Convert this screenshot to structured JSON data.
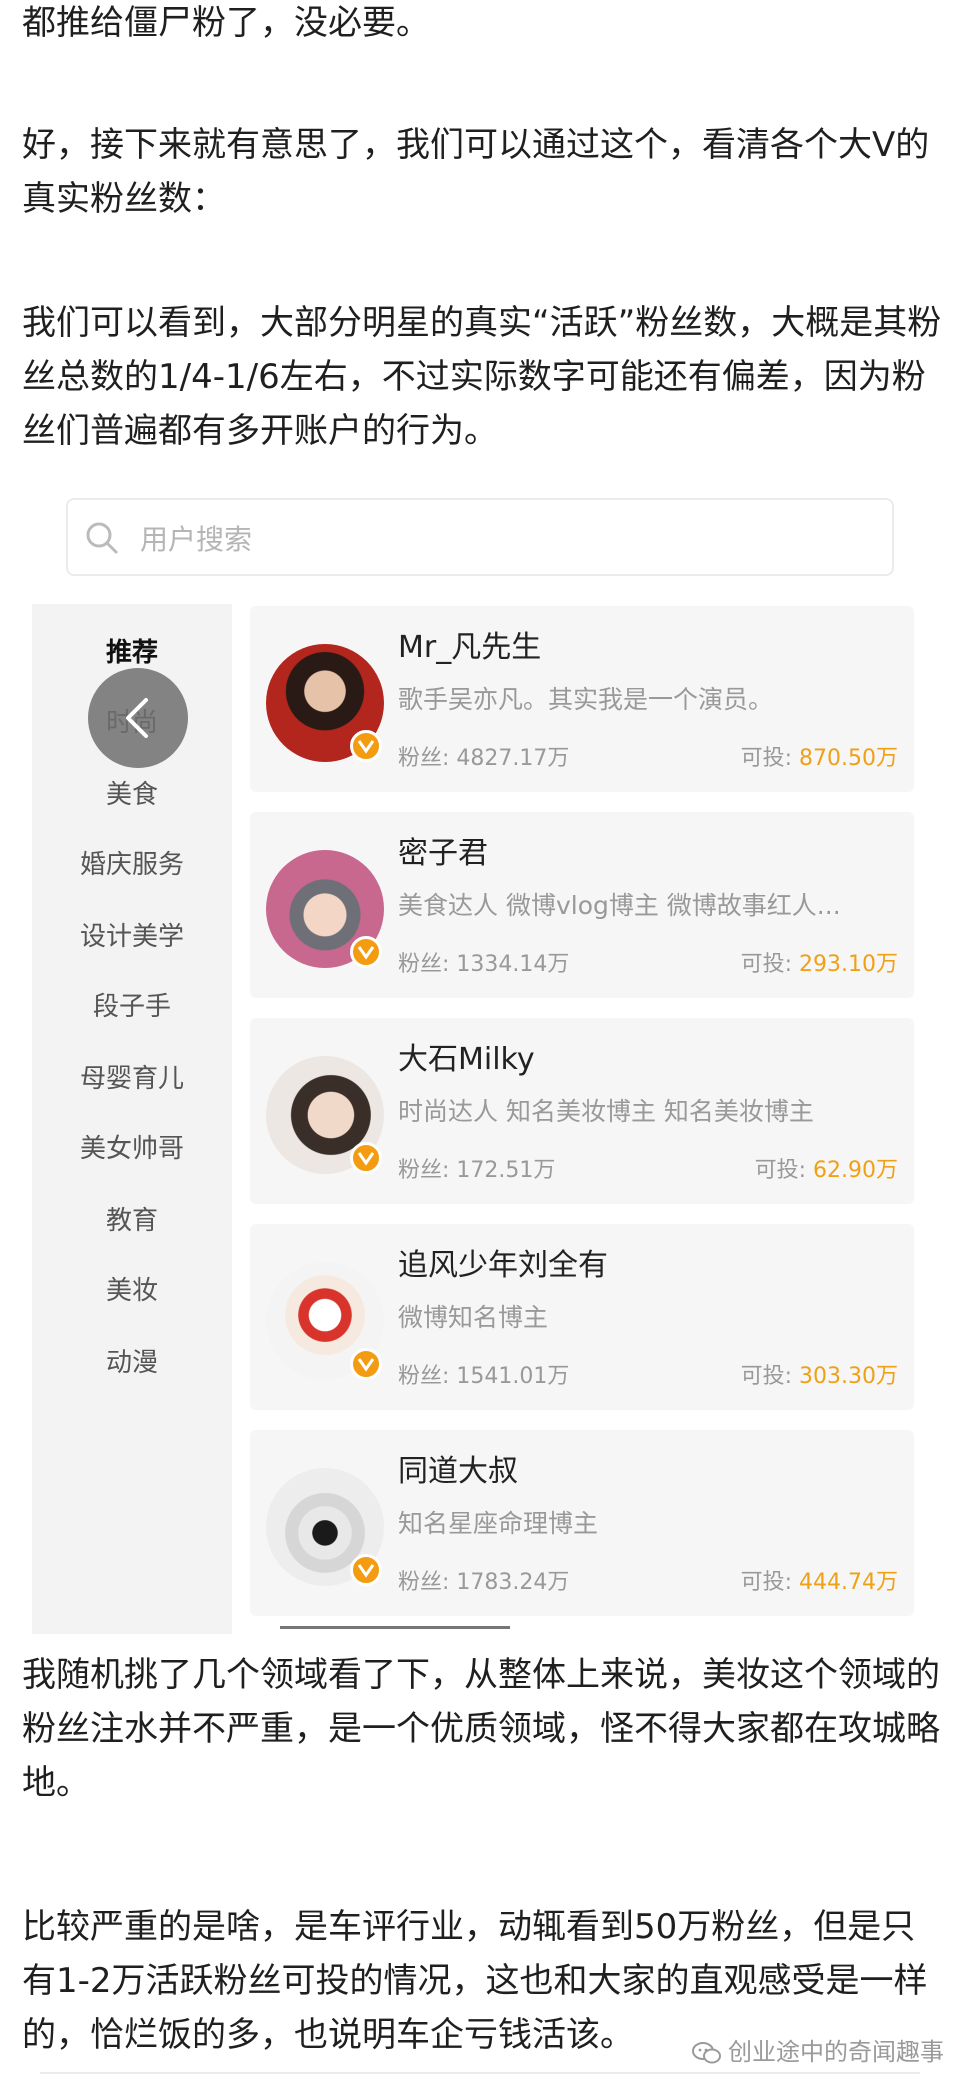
{
  "article": {
    "p0": "都推给僵尸粉了，没必要。",
    "p1": "好，接下来就有意思了，我们可以通过这个，看清各个大V的真实粉丝数：",
    "p2": "我们可以看到，大部分明星的真实“活跃”粉丝数，大概是其粉丝总数的1/4-1/6左右，不过实际数字可能还有偏差，因为粉丝们普遍都有多开账户的行为。",
    "p3": "我随机挑了几个领域看了下，从整体上来说，美妆这个领域的粉丝注水并不严重，是一个优质领域，怪不得大家都在攻城略地。",
    "p4": "比较严重的是啥，是车评行业，动辄看到50万粉丝，但是只有1-2万活跃粉丝可投的情况，这也和大家的直观感受是一样的，恰烂饭的多，也说明车企亏钱活该。"
  },
  "screenshot": {
    "search_placeholder": "用户搜索",
    "categories": [
      "推荐",
      "时尚",
      "美食",
      "婚庆服务",
      "设计美学",
      "段子手",
      "母婴育儿",
      "美女帅哥",
      "教育",
      "美妆",
      "动漫"
    ],
    "fans_label": "粉丝:",
    "tou_label": "可投:",
    "users": [
      {
        "name": "Mr_凡先生",
        "desc": "歌手吴亦凡。其实我是一个演员。",
        "fans": "4827.17万",
        "tou": "870.50万"
      },
      {
        "name": "密子君",
        "desc": "美食达人 微博vlog博主 微博故事红人...",
        "fans": "1334.14万",
        "tou": "293.10万"
      },
      {
        "name": "大石Milky",
        "desc": "时尚达人 知名美妆博主 知名美妆博主",
        "fans": "172.51万",
        "tou": "62.90万"
      },
      {
        "name": "追风少年刘全有",
        "desc": "微博知名博主",
        "fans": "1541.01万",
        "tou": "303.30万"
      },
      {
        "name": "同道大叔",
        "desc": "知名星座命理博主",
        "fans": "1783.24万",
        "tou": "444.74万"
      }
    ]
  },
  "watermark": "创业途中的奇闻趣事",
  "colors": {
    "accent_orange": "#f0a015",
    "badge": "#f39c12"
  }
}
